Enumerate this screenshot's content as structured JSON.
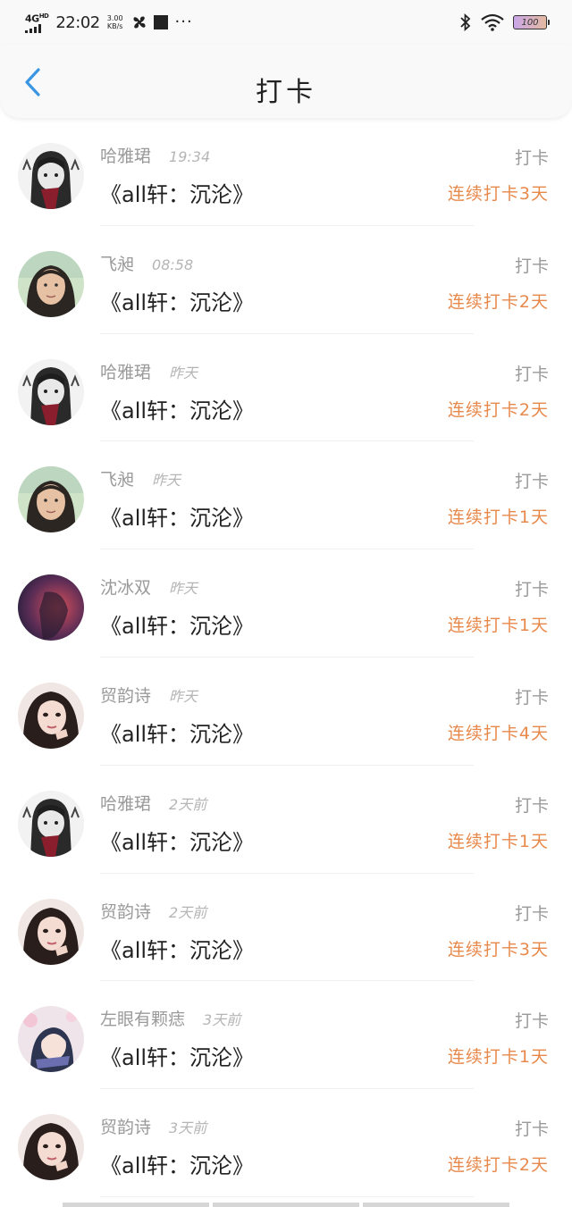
{
  "status_bar": {
    "network": "4G",
    "network_sup": "HD",
    "time": "22:02",
    "speed_value": "3.00",
    "speed_unit": "KB/s",
    "more": "···",
    "battery": "100"
  },
  "header": {
    "title": "打卡",
    "back_icon": "chevron-left-icon"
  },
  "colors": {
    "accent": "#3a96e2",
    "streak": "#e8894c",
    "muted": "#9a9a9a"
  },
  "entries": [
    {
      "avatar": "cartoon-girl-avatar",
      "name": "哈雅珺",
      "time": "19:34",
      "action": "打卡",
      "book": "《all轩：沉沦》",
      "streak": "连续打卡3天"
    },
    {
      "avatar": "photo-girl-avatar",
      "name": "飞昶",
      "time": "08:58",
      "action": "打卡",
      "book": "《all轩：沉沦》",
      "streak": "连续打卡2天"
    },
    {
      "avatar": "cartoon-girl-avatar",
      "name": "哈雅珺",
      "time": "昨天",
      "action": "打卡",
      "book": "《all轩：沉沦》",
      "streak": "连续打卡2天"
    },
    {
      "avatar": "photo-girl-avatar",
      "name": "飞昶",
      "time": "昨天",
      "action": "打卡",
      "book": "《all轩：沉沦》",
      "streak": "连续打卡1天"
    },
    {
      "avatar": "dark-red-photo-avatar",
      "name": "沈冰双",
      "time": "昨天",
      "action": "打卡",
      "book": "《all轩：沉沦》",
      "streak": "连续打卡1天"
    },
    {
      "avatar": "portrait-girl-avatar",
      "name": "贸韵诗",
      "time": "昨天",
      "action": "打卡",
      "book": "《all轩：沉沦》",
      "streak": "连续打卡4天"
    },
    {
      "avatar": "cartoon-girl-avatar",
      "name": "哈雅珺",
      "time": "2天前",
      "action": "打卡",
      "book": "《all轩：沉沦》",
      "streak": "连续打卡1天"
    },
    {
      "avatar": "portrait-girl-avatar",
      "name": "贸韵诗",
      "time": "2天前",
      "action": "打卡",
      "book": "《all轩：沉沦》",
      "streak": "连续打卡3天"
    },
    {
      "avatar": "anime-girl-avatar",
      "name": "左眼有颗痣",
      "time": "3天前",
      "action": "打卡",
      "book": "《all轩：沉沦》",
      "streak": "连续打卡1天"
    },
    {
      "avatar": "portrait-girl-avatar",
      "name": "贸韵诗",
      "time": "3天前",
      "action": "打卡",
      "book": "《all轩：沉沦》",
      "streak": "连续打卡2天"
    }
  ]
}
